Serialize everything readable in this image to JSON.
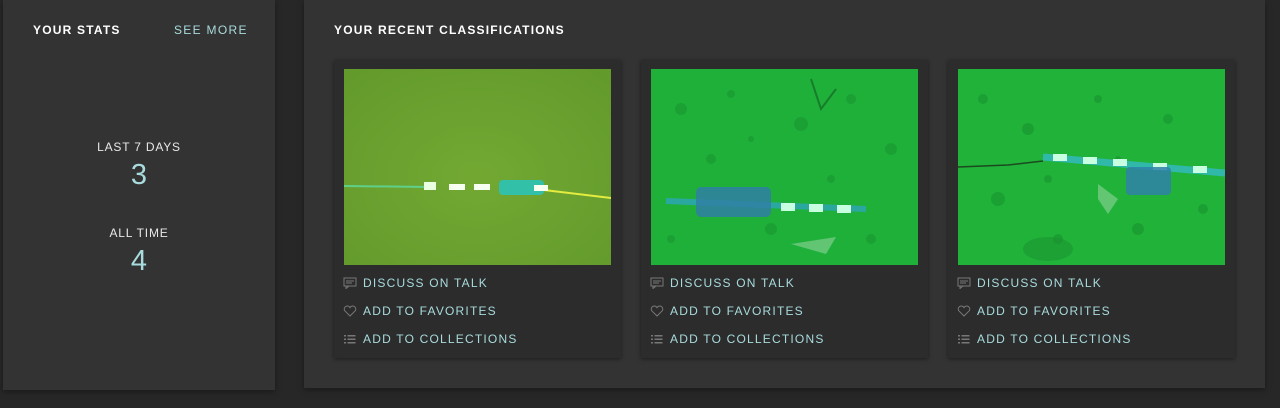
{
  "stats": {
    "title": "YOUR STATS",
    "see_more": "SEE MORE",
    "last7_label": "LAST 7 DAYS",
    "last7_value": "3",
    "alltime_label": "ALL TIME",
    "alltime_value": "4"
  },
  "recent": {
    "title": "YOUR RECENT CLASSIFICATIONS",
    "actions": {
      "talk": "DISCUSS ON TALK",
      "favorites": "ADD TO FAVORITES",
      "collections": "ADD TO COLLECTIONS"
    },
    "cards": [
      {
        "thumbnail_color": "#6ba32e"
      },
      {
        "thumbnail_color": "#1fb33a"
      },
      {
        "thumbnail_color": "#22b53a"
      }
    ]
  },
  "colors": {
    "accent": "#a8dbdd",
    "panel_bg": "#333333",
    "page_bg": "#272727"
  },
  "icons": {
    "talk": "speech-bubble-icon",
    "favorites": "heart-icon",
    "collections": "list-icon"
  }
}
